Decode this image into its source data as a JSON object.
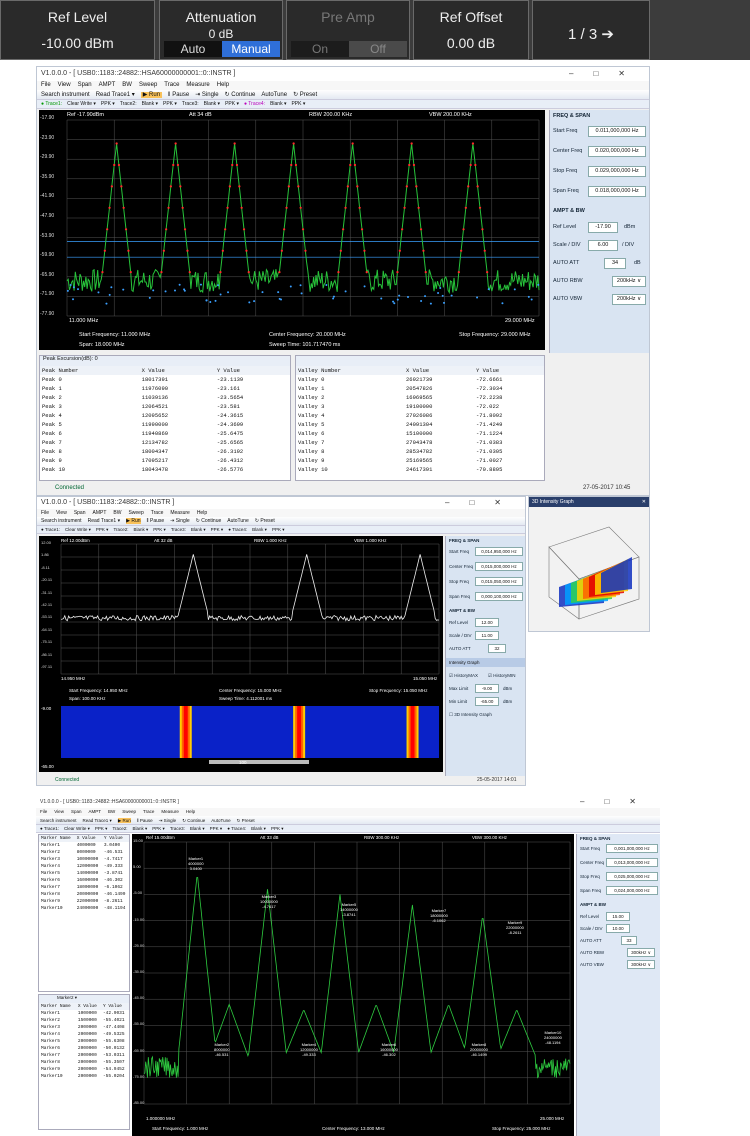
{
  "instrument_bar": {
    "ref_level": {
      "label": "Ref Level",
      "value": "-10.00 dBm"
    },
    "attenuation": {
      "label": "Attenuation",
      "value": "0 dB",
      "auto": "Auto",
      "manual": "Manual"
    },
    "pre_amp": {
      "label": "Pre Amp",
      "on": "On",
      "off": "Off"
    },
    "ref_offset": {
      "label": "Ref Offset",
      "value": "0.00 dB"
    },
    "page": "1 / 3 ➔"
  },
  "win1": {
    "title": "V1.0.0.0  -  [ USB0::1183::24882::HSA60000000001::0::INSTR ]",
    "menu": [
      "File",
      "View",
      "Span",
      "AMPT",
      "BW",
      "Sweep",
      "Trace",
      "Measure",
      "Help"
    ],
    "toolbar": [
      "Search instrument",
      "Read Trace1 ▾",
      "▶ Run",
      "‖ Pause",
      "⇥ Single",
      "↻ Continue",
      "AutoTune",
      "↻ Preset"
    ],
    "traces": [
      "● Trace1:",
      "Clear Write ▾",
      "PPK ▾",
      "Trace2:",
      "Blank ▾",
      "PPK ▾",
      "Trace3:",
      "Blank ▾",
      "PPK ▾",
      "● Trace4:",
      "Blank ▾",
      "PPK ▾"
    ],
    "plot_header": {
      "ref": "Ref -17.90dBm",
      "att": "Att 34 dB",
      "rbw": "RBW 200.00 KHz",
      "vbw": "VBW 200.00 KHz"
    },
    "y_ticks": [
      "-17.90",
      "-23.90",
      "-29.90",
      "-35.90",
      "-41.90",
      "-47.90",
      "-53.90",
      "-59.90",
      "-65.90",
      "-71.90",
      "-77.90"
    ],
    "x_start": "11.000 MHz",
    "x_stop": "29.000 MHz",
    "footer": {
      "start": "Start Frequency: 11.000 MHz",
      "center": "Center Frequency: 20.000 MHz",
      "stop": "Stop Frequency: 29.000 MHz",
      "span": "Span: 18.000 MHz",
      "sweep": "Sweep Time: 101.717470 ms"
    },
    "panel": {
      "freq_header": "FREQ & SPAN",
      "start_label": "Start Freq",
      "start": "0.011,000,000 Hz",
      "center_label": "Center Freq",
      "center": "0.020,000,000 Hz",
      "stop_label": "Stop Freq",
      "stop": "0.029,000,000 Hz",
      "span_label": "Span Freq",
      "span": "0.018,000,000 Hz",
      "ampt_header": "AMPT & BW",
      "ref_label": "Ref Level",
      "ref": "-17.90",
      "ref_unit": "dBm",
      "scale_label": "Scale / DIV",
      "scale": "6.00",
      "scale_unit": "/ DIV",
      "att_label": "AUTO    ATT",
      "att": "34",
      "att_unit": "dB",
      "rbw_label": "AUTO    RBW",
      "rbw": "200kHz ∨",
      "vbw_label": "AUTO    VBW",
      "vbw": "200kHz ∨"
    },
    "peak_table": {
      "toolbar": "Peak Excursion(dB): 0",
      "headers": [
        "Peak Number",
        "X Value",
        "Y Value"
      ],
      "rows": [
        [
          "Peak 0",
          "18017391",
          "-23.1139"
        ],
        [
          "Peak 1",
          "11976090",
          "-23.161"
        ],
        [
          "Peak 2",
          "11039136",
          "-23.5654"
        ],
        [
          "Peak 3",
          "12064521",
          "-23.581"
        ],
        [
          "Peak 4",
          "12095652",
          "-24.3615"
        ],
        [
          "Peak 5",
          "11990000",
          "-24.3699"
        ],
        [
          "Peak 6",
          "11940869",
          "-25.6475"
        ],
        [
          "Peak 7",
          "12134782",
          "-25.6565"
        ],
        [
          "Peak 8",
          "18004347",
          "-26.3192"
        ],
        [
          "Peak 9",
          "17095217",
          "-26.4312"
        ],
        [
          "Peak 10",
          "18043478",
          "-26.5776"
        ]
      ]
    },
    "valley_table": {
      "headers": [
        "Valley Number",
        "X Value",
        "Y Value"
      ],
      "rows": [
        [
          "Valley 0",
          "26921739",
          "-72.6661"
        ],
        [
          "Valley 1",
          "20547826",
          "-72.3034"
        ],
        [
          "Valley 2",
          "16969565",
          "-72.2238"
        ],
        [
          "Valley 3",
          "19100000",
          "-72.022"
        ],
        [
          "Valley 4",
          "27026086",
          "-71.8092"
        ],
        [
          "Valley 5",
          "24091304",
          "-71.4249"
        ],
        [
          "Valley 6",
          "15100000",
          "-71.1224"
        ],
        [
          "Valley 7",
          "27043478",
          "-71.0383"
        ],
        [
          "Valley 8",
          "28534782",
          "-71.0305"
        ],
        [
          "Valley 9",
          "25169565",
          "-71.0027"
        ],
        [
          "Valley 10",
          "24617391",
          "-70.8895"
        ]
      ]
    },
    "status": "Connected",
    "timestamp": "27-05-2017  10:45"
  },
  "win2": {
    "title": "V1.0.0.0  -  [ USB0::1183::24882::0::INSTR ]",
    "toolbar": [
      "Search instrument",
      "Read Trace1 ▾",
      "▶ Run",
      "‖ Pause",
      "⇥ Single",
      "↻ Continue",
      "AutoTune",
      "↻ Preset"
    ],
    "traces": [
      "● Trace1:",
      "Clear Write ▾",
      "PPK ▾",
      "Trace2:",
      "Blank ▾",
      "PPK ▾",
      "Trace3:",
      "Blank ▾",
      "PPK ▾",
      "● Trace4:",
      "Blank ▾",
      "PPK ▾"
    ],
    "plot_header": {
      "ref": "Ref 12.00dBm",
      "att": "Att 32 dB",
      "rbw": "RBW 1.000 KHz",
      "vbw": "VBW 1.000 KHz"
    },
    "y_ticks": [
      "12.00",
      "1.86",
      "-8.11",
      "-20.11",
      "-31.11",
      "-42.11",
      "-53.11",
      "-64.11",
      "-75.11",
      "-86.11",
      "-97.11"
    ],
    "x_start": "14.950 MHz",
    "x_stop": "15.050 MHz",
    "footer": {
      "start": "Start Frequency: 14.950 MHz",
      "center": "Center Frequency: 15.000 MHz",
      "stop": "Stop Frequency: 15.050 MHz",
      "span": "Span: 100.00 KHz",
      "sweep": "Sweep Time: 4.112001 ms"
    },
    "panel": {
      "start": "0,014,950,000 Hz",
      "center": "0,015,000,000 Hz",
      "stop": "0,015,050,000 Hz",
      "span": "0,000,100,000 Hz",
      "ref": "12.00",
      "scale": "11.00",
      "att": "32",
      "ig_header": "Intensity Graph",
      "hist_max": "HistoryMAX",
      "hist_min": "HistoryMIN",
      "max_label": "Max Limit",
      "max_val": "-9.00",
      "min_label": "Min Limit",
      "min_val": "-65.00",
      "unit": "dBm",
      "three_d": "3D Intensity Graph"
    },
    "wf_top": "-9.00",
    "wf_bottom": "-65.00",
    "wf_scroll": "100",
    "status": "Connected",
    "timestamp": "25-05-2017  14:01",
    "graph3d_title": "3D Intensity Graph"
  },
  "win3": {
    "title": "V1.0.0.0  -  [ USB0::1183::24882::HSA60000000001::0::INSTR ]",
    "menu": [
      "File",
      "View",
      "Span",
      "AMPT",
      "BW",
      "Sweep",
      "Trace",
      "Measure",
      "Help"
    ],
    "toolbar": [
      "Search instrument",
      "Read Trace1 ▾",
      "▶ Run",
      "‖ Pause",
      "⇥ Single",
      "↻ Continue",
      "AutoTune",
      "↻ Preset"
    ],
    "plot_header": {
      "ref": "Ref 15.00dBm",
      "att": "Att 33 dB",
      "rbw": "RBW 300.00 KHz",
      "vbw": "VBW 300.00 KHz"
    },
    "y_ticks": [
      "15.00",
      "5.00",
      "-5.00",
      "-15.00",
      "-25.00",
      "-35.00",
      "-45.00",
      "-55.00",
      "-65.00",
      "-75.00",
      "-85.00"
    ],
    "x_start": "1.000000 MHz",
    "x_stop": "25.000 MHz",
    "footer": {
      "start": "Start Frequency: 1.000 MHz",
      "center": "Center Frequency: 13.000 MHz",
      "stop": "Stop Frequency: 25.000 MHz"
    },
    "marker_headers": [
      "Marker Name",
      "X Value",
      "Y Value"
    ],
    "markers_top": [
      [
        "Marker1",
        "4000000",
        "3.0400"
      ],
      [
        "Marker2",
        "8000000",
        "-46.531"
      ],
      [
        "Marker3",
        "10000000",
        "-4.7417"
      ],
      [
        "Marker4",
        "12000000",
        "-49.333"
      ],
      [
        "Marker5",
        "14000000",
        "-3.8741"
      ],
      [
        "Marker6",
        "16000000",
        "-46.302"
      ],
      [
        "Marker7",
        "18000000",
        "-6.1062"
      ],
      [
        "Marker8",
        "20000000",
        "-46.1499"
      ],
      [
        "Marker9",
        "22000000",
        "-8.2611"
      ],
      [
        "Marker10",
        "24000000",
        "-48.1194"
      ]
    ],
    "markers_bottom": [
      [
        "Marker1",
        "1000000",
        "-42.9031"
      ],
      [
        "Marker2",
        "1500000",
        "-55.4021"
      ],
      [
        "Marker3",
        "2000000",
        "-47.4408"
      ],
      [
        "Marker4",
        "2000000",
        "-49.5325"
      ],
      [
        "Marker5",
        "2000000",
        "-55.6308"
      ],
      [
        "Marker6",
        "2000000",
        "-50.0132"
      ],
      [
        "Marker7",
        "2000000",
        "-53.0311"
      ],
      [
        "Marker8",
        "2000000",
        "-55.3507"
      ],
      [
        "Marker9",
        "2000000",
        "-54.9452"
      ],
      [
        "Marker10",
        "2000000",
        "-55.0204"
      ]
    ],
    "labels": [
      {
        "name": "Marker1",
        "x": "4000000",
        "y": "3.0400"
      },
      {
        "name": "Marker2",
        "x": "8000000",
        "y": "-46.531"
      },
      {
        "name": "Marker3",
        "x": "10000000",
        "y": "-4.7417"
      },
      {
        "name": "Marker4",
        "x": "12000000",
        "y": "-49.333"
      },
      {
        "name": "Marker5",
        "x": "14000000",
        "y": "-3.8741"
      },
      {
        "name": "Marker6",
        "x": "16000000",
        "y": "-46.302"
      },
      {
        "name": "Marker7",
        "x": "18000000",
        "y": "-6.1062"
      },
      {
        "name": "Marker8",
        "x": "20000000",
        "y": "-46.1499"
      },
      {
        "name": "Marker9",
        "x": "22000000",
        "y": "-8.2611"
      },
      {
        "name": "Marker10",
        "x": "24000000",
        "y": "-48.1194"
      }
    ],
    "panel": {
      "start": "0,001,000,000 Hz",
      "center": "0,013,000,000 Hz",
      "stop": "0,025,000,000 Hz",
      "span": "0,024,000,000 Hz",
      "ref": "15.00",
      "scale": "10.00",
      "att": "33",
      "rbw": "300kHz ∨",
      "vbw": "300kHz ∨"
    },
    "marker_toolbar": "Marker2 ▾"
  }
}
